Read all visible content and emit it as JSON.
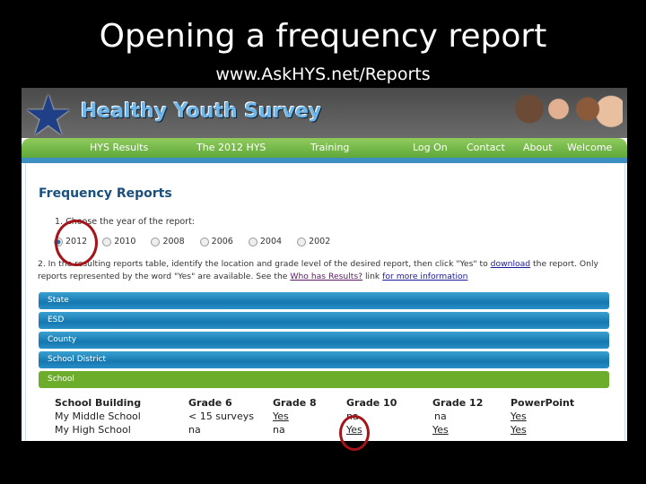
{
  "slide": {
    "title": "Opening a frequency report",
    "subtitle": "www.AskHYS.net/Reports"
  },
  "site": {
    "logo_text": "Healthy Youth Survey",
    "nav": [
      "HYS Results",
      "The 2012 HYS",
      "Training",
      "Log On",
      "Contact",
      "About",
      "Welcome"
    ]
  },
  "page": {
    "heading": "Frequency Reports",
    "step1": "1. Choose the year of the report:",
    "years": [
      "2012",
      "2010",
      "2008",
      "2006",
      "2004",
      "2002"
    ],
    "selected_year": "2012",
    "step2_a": "2. In the resulting reports table, identify the location and grade level of the desired report, then click \"Yes\" to ",
    "step2_link1": "download",
    "step2_b": " the report. Only reports represented by the word \"Yes\" are available. See the ",
    "step2_link2": "Who has Results?",
    "step2_c": " link ",
    "step2_link3": "for more information",
    "levels": [
      "State",
      "ESD",
      "County",
      "School District",
      "School"
    ],
    "active_level": "School",
    "table": {
      "headers": [
        "School Building",
        "Grade 6",
        "Grade 8",
        "Grade 10",
        "Grade 12",
        "PowerPoint"
      ],
      "rows": [
        [
          "My Middle School",
          "< 15 surveys",
          "Yes",
          "na",
          "na",
          "Yes"
        ],
        [
          "My High School",
          "na",
          "na",
          "Yes",
          "Yes",
          "Yes"
        ]
      ]
    }
  },
  "colors": {
    "annotation_circle": "#a3151a",
    "nav_green": "#6dad2c",
    "bar_blue": "#1578b0"
  }
}
